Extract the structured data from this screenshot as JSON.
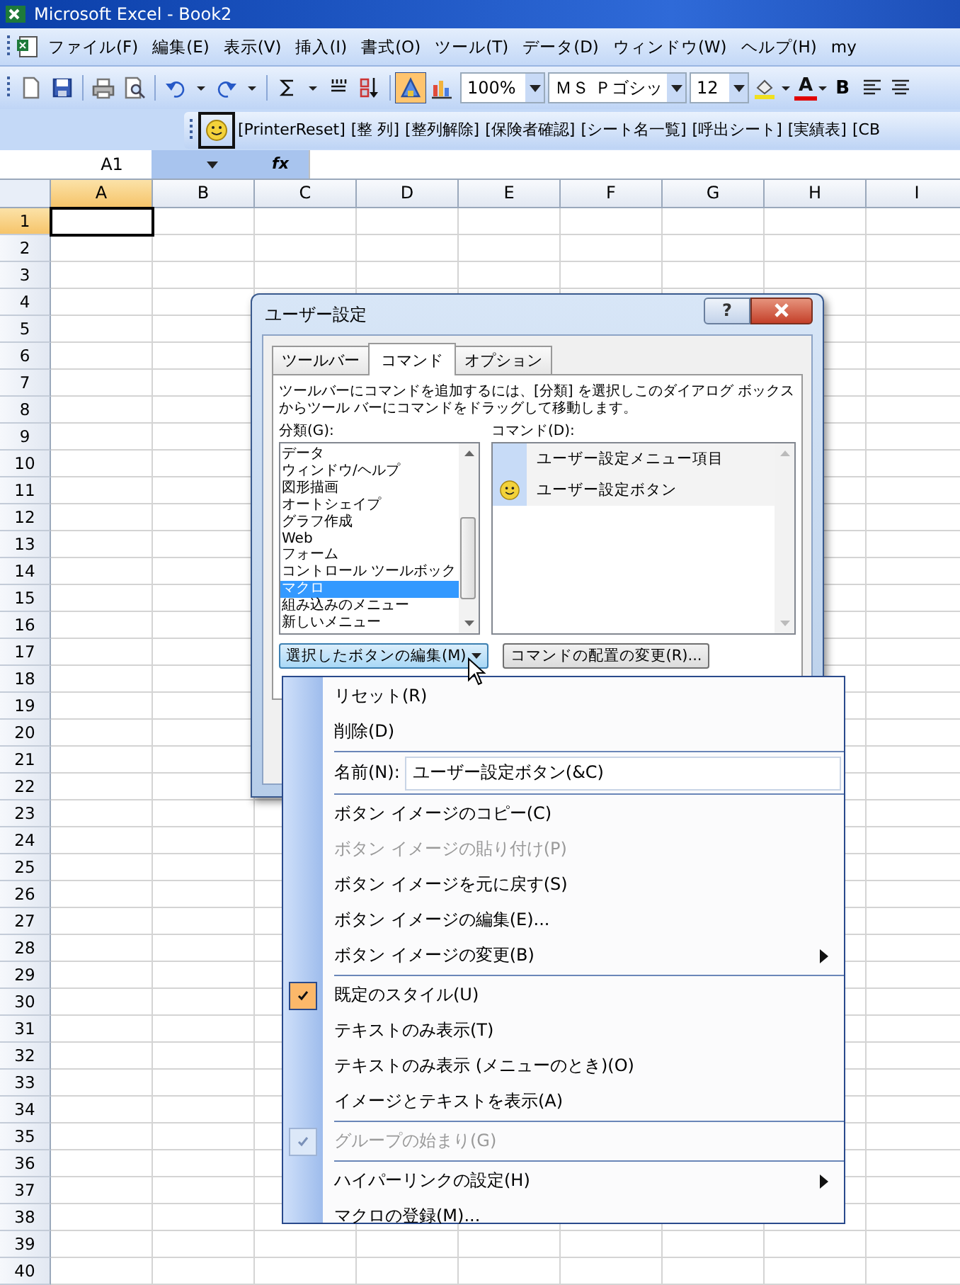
{
  "window": {
    "title": "Microsoft Excel - Book2"
  },
  "menu_bar": [
    "ファイル(F)",
    "編集(E)",
    "表示(V)",
    "挿入(I)",
    "書式(O)",
    "ツール(T)",
    "データ(D)",
    "ウィンドウ(W)",
    "ヘルプ(H)",
    "my"
  ],
  "toolbar": {
    "buttons": [
      {
        "hot": false
      },
      {
        "hot": false
      },
      {
        "hot": false
      },
      {
        "hot": false
      },
      {
        "hot": false
      },
      {
        "hot": false
      },
      {
        "hot": false
      },
      {
        "hot": false
      },
      {
        "hot": false
      },
      {
        "hot": false
      },
      {
        "hot": false
      },
      {
        "hot": false
      },
      {
        "hot": true
      },
      {
        "hot": false
      }
    ],
    "zoom": "100%",
    "font": "ＭＳ Ｐゴシッ",
    "size": "12",
    "font_color_label": "A",
    "bold_label": "B"
  },
  "macro_toolbar": {
    "smiley_selected": true,
    "items": [
      "[PrinterReset]",
      "[整 列]",
      "[整列解除]",
      "[保険者確認]",
      "[シート名一覧]",
      "[呼出シート]",
      "[実績表]",
      "[CB"
    ]
  },
  "formula_bar": {
    "name_box": "A1",
    "fx": "fx"
  },
  "sheet": {
    "columns": [
      {
        "label": "A",
        "selected": true
      },
      {
        "label": "B",
        "selected": false
      },
      {
        "label": "C",
        "selected": false
      },
      {
        "label": "D",
        "selected": false
      },
      {
        "label": "E",
        "selected": false
      },
      {
        "label": "F",
        "selected": false
      },
      {
        "label": "G",
        "selected": false
      },
      {
        "label": "H",
        "selected": false
      },
      {
        "label": "I",
        "selected": false
      }
    ],
    "rows": [
      {
        "label": "1",
        "selected": true
      },
      {
        "label": "2",
        "selected": false
      },
      {
        "label": "3",
        "selected": false
      },
      {
        "label": "4",
        "selected": false
      },
      {
        "label": "5",
        "selected": false
      },
      {
        "label": "6",
        "selected": false
      },
      {
        "label": "7",
        "selected": false
      },
      {
        "label": "8",
        "selected": false
      },
      {
        "label": "9",
        "selected": false
      },
      {
        "label": "10",
        "selected": false
      },
      {
        "label": "11",
        "selected": false
      },
      {
        "label": "12",
        "selected": false
      },
      {
        "label": "13",
        "selected": false
      },
      {
        "label": "14",
        "selected": false
      },
      {
        "label": "15",
        "selected": false
      },
      {
        "label": "16",
        "selected": false
      },
      {
        "label": "17",
        "selected": false
      },
      {
        "label": "18",
        "selected": false
      },
      {
        "label": "19",
        "selected": false
      },
      {
        "label": "20",
        "selected": false
      },
      {
        "label": "21",
        "selected": false
      },
      {
        "label": "22",
        "selected": false
      },
      {
        "label": "23",
        "selected": false
      },
      {
        "label": "24",
        "selected": false
      },
      {
        "label": "25",
        "selected": false
      },
      {
        "label": "26",
        "selected": false
      },
      {
        "label": "27",
        "selected": false
      },
      {
        "label": "28",
        "selected": false
      },
      {
        "label": "29",
        "selected": false
      },
      {
        "label": "30",
        "selected": false
      },
      {
        "label": "31",
        "selected": false
      },
      {
        "label": "32",
        "selected": false
      },
      {
        "label": "33",
        "selected": false
      },
      {
        "label": "34",
        "selected": false
      },
      {
        "label": "35",
        "selected": false
      },
      {
        "label": "36",
        "selected": false
      },
      {
        "label": "37",
        "selected": false
      },
      {
        "label": "38",
        "selected": false
      },
      {
        "label": "39",
        "selected": false
      },
      {
        "label": "40",
        "selected": false
      }
    ]
  },
  "dialog": {
    "title": "ユーザー設定",
    "help": "?",
    "tabs": [
      {
        "label": "ツールバー",
        "selected": false
      },
      {
        "label": "コマンド",
        "selected": true
      },
      {
        "label": "オプション",
        "selected": false
      }
    ],
    "description": "ツールバーにコマンドを追加するには、[分類] を選択しこのダイアログ ボックスからツール バーにコマンドをドラッグして移動します。",
    "category_label": "分類(G):",
    "categories": [
      {
        "label": "データ",
        "selected": false
      },
      {
        "label": "ウィンドウ/ヘルプ",
        "selected": false
      },
      {
        "label": "図形描画",
        "selected": false
      },
      {
        "label": "オートシェイプ",
        "selected": false
      },
      {
        "label": "グラフ作成",
        "selected": false
      },
      {
        "label": "Web",
        "selected": false
      },
      {
        "label": "フォーム",
        "selected": false
      },
      {
        "label": "コントロール ツールボック",
        "selected": false
      },
      {
        "label": "マクロ",
        "selected": true
      },
      {
        "label": "組み込みのメニュー",
        "selected": false
      },
      {
        "label": "新しいメニュー",
        "selected": false
      }
    ],
    "command_label": "コマンド(D):",
    "commands": [
      {
        "label": "ユーザー設定メニュー項目",
        "kind": "menu"
      },
      {
        "label": "ユーザー設定ボタン",
        "kind": "button"
      }
    ],
    "buttons": [
      {
        "label": "選択したボタンの編集(M)",
        "kind": "dropdown"
      },
      {
        "label": "コマンドの配置の変更(R)...",
        "kind": "plain"
      }
    ]
  },
  "context_menu": [
    {
      "kind": "item",
      "label": "リセット(R)",
      "checked": false,
      "disabled": false,
      "submenu": false
    },
    {
      "kind": "item",
      "label": "削除(D)",
      "checked": false,
      "disabled": false,
      "submenu": false
    },
    {
      "kind": "separator"
    },
    {
      "kind": "field",
      "label": "名前(N):",
      "value": "ユーザー設定ボタン(&C)"
    },
    {
      "kind": "separator"
    },
    {
      "kind": "item",
      "label": "ボタン イメージのコピー(C)",
      "checked": false,
      "disabled": false,
      "submenu": false
    },
    {
      "kind": "item",
      "label": "ボタン イメージの貼り付け(P)",
      "checked": false,
      "disabled": true,
      "submenu": false
    },
    {
      "kind": "item",
      "label": "ボタン イメージを元に戻す(S)",
      "checked": false,
      "disabled": false,
      "submenu": false
    },
    {
      "kind": "item",
      "label": "ボタン イメージの編集(E)...",
      "checked": false,
      "disabled": false,
      "submenu": false
    },
    {
      "kind": "item",
      "label": "ボタン イメージの変更(B)",
      "checked": false,
      "disabled": false,
      "submenu": true
    },
    {
      "kind": "separator"
    },
    {
      "kind": "item",
      "label": "既定のスタイル(U)",
      "checked": true,
      "disabled": false,
      "submenu": false
    },
    {
      "kind": "item",
      "label": "テキストのみ表示(T)",
      "checked": false,
      "disabled": false,
      "submenu": false
    },
    {
      "kind": "item",
      "label": "テキストのみ表示 (メニューのとき)(O)",
      "checked": false,
      "disabled": false,
      "submenu": false
    },
    {
      "kind": "item",
      "label": "イメージとテキストを表示(A)",
      "checked": false,
      "disabled": false,
      "submenu": false
    },
    {
      "kind": "separator"
    },
    {
      "kind": "item",
      "label": "グループの始まり(G)",
      "checked": true,
      "disabled": true,
      "submenu": false
    },
    {
      "kind": "separator"
    },
    {
      "kind": "item",
      "label": "ハイパーリンクの設定(H)",
      "checked": false,
      "disabled": false,
      "submenu": true
    },
    {
      "kind": "item",
      "label": "マクロの登録(M)...",
      "checked": false,
      "disabled": false,
      "submenu": false
    }
  ]
}
